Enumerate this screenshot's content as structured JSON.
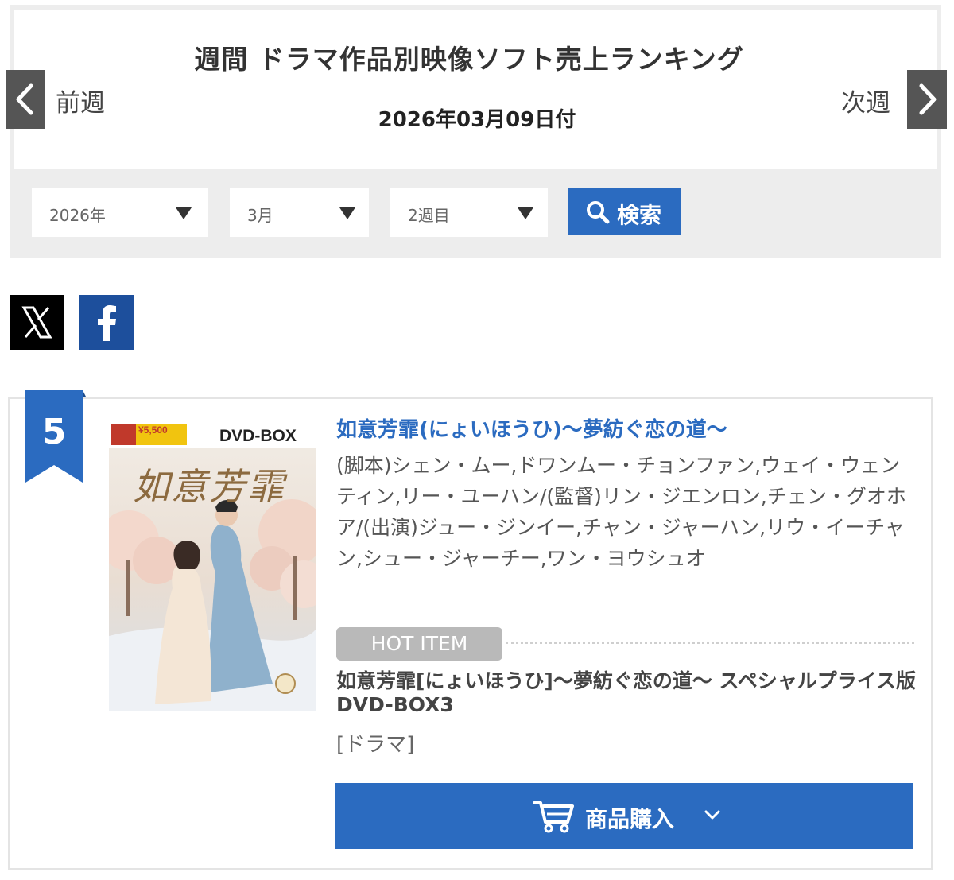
{
  "header": {
    "title": "週間 ドラマ作品別映像ソフト売上ランキング",
    "date": "2026年03月09日付",
    "prev_label": "前週",
    "next_label": "次週",
    "prev_icon": "chevron-left-icon",
    "next_icon": "chevron-right-icon"
  },
  "filters": {
    "year": "2026年",
    "month": "3月",
    "week": "2週目",
    "search_label": "検索",
    "search_icon": "search-icon"
  },
  "share": {
    "x_icon": "x-logo-icon",
    "facebook_icon": "facebook-logo-icon"
  },
  "ranking": {
    "rank": "5",
    "work_title": "如意芳霏(にょいほうひ)〜夢紡ぐ恋の道〜",
    "credits": "(脚本)シェン・ムー,ドワンムー・チョンファン,ウェイ・ウェンティン,リー・ユーハン/(監督)リン・ジエンロン,チェン・グオホア/(出演)ジュー・ジンイー,チャン・ジャーハン,リウ・イーチャン,シュー・ジャーチー,ワン・ヨウシュオ",
    "hot_item_label": "HOT ITEM",
    "product_name": "如意芳霏[にょいほうひ]〜夢紡ぐ恋の道〜 スペシャルプライス版DVD-BOX3",
    "genre": "[ドラマ]",
    "buy_label": "商品購入",
    "jacket": {
      "badge_text": "DVD-BOX",
      "price_text": "¥5,500",
      "title_text": "如意芳霏"
    }
  },
  "colors": {
    "accent_blue": "#2b6bc0",
    "panel_gray": "#ededed",
    "nav_dark": "#555555",
    "facebook_blue": "#1d4f9c"
  }
}
